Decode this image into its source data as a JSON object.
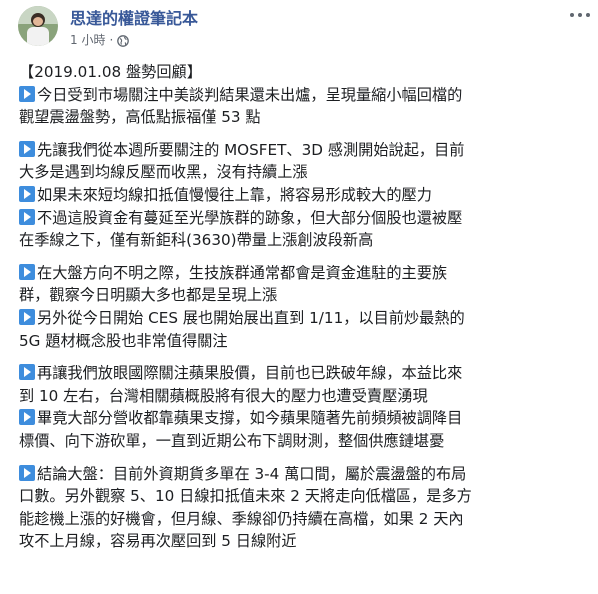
{
  "author": {
    "name": "思達的權證筆記本"
  },
  "meta": {
    "time": "1 小時",
    "separator": "·"
  },
  "icons": {
    "play": "play-button-icon",
    "globe": "globe-icon",
    "more": "more-options-icon"
  },
  "colors": {
    "author_link": "#385898",
    "icon_blue": "#3e8ddd",
    "text": "#1c1e21",
    "meta": "#616770"
  },
  "post": {
    "p1": {
      "title": "【2019.01.08 盤勢回顧】",
      "l1": "今日受到市場關注中美談判結果還未出爐，呈現量縮小幅回檔的",
      "l2": "觀望震盪盤勢，高低點振福僅 53 點"
    },
    "p2": {
      "l1": "先讓我們從本週所要關注的 MOSFET、3D 感測開始說起，目前",
      "l2": "大多是遇到均線反壓而收黑，沒有持續上漲",
      "l3": "如果未來短均線扣抵值慢慢往上靠，將容易形成較大的壓力",
      "l4": "不過這股資金有蔓延至光學族群的跡象，但大部分個股也還被壓",
      "l5": "在季線之下，僅有新鉅科(3630)帶量上漲創波段新高"
    },
    "p3": {
      "l1": "在大盤方向不明之際，生技族群通常都會是資金進駐的主要族",
      "l2": "群，觀察今日明顯大多也都是呈現上漲",
      "l3": "另外從今日開始 CES 展也開始展出直到 1/11，以目前炒最熱的",
      "l4": "5G 題材概念股也非常值得關注"
    },
    "p4": {
      "l1": "再讓我們放眼國際關注蘋果股價，目前也已跌破年線，本益比來",
      "l2": "到 10 左右，台灣相關蘋概股將有很大的壓力也遭受賣壓湧現",
      "l3": "畢竟大部分營收都靠蘋果支撐，如今蘋果隨著先前頻頻被調降目",
      "l4": "標價、向下游砍單，一直到近期公布下調財測，整個供應鏈堪憂"
    },
    "p5": {
      "l1": "結論大盤：目前外資期貨多單在 3-4 萬口間，屬於震盪盤的布局",
      "l2": "口數。另外觀察 5、10 日線扣抵值未來 2 天將走向低檔區，是多方",
      "l3": "能趁機上漲的好機會，但月線、季線卻仍持續在高檔，如果 2 天內",
      "l4": "攻不上月線，容易再次壓回到 5 日線附近"
    }
  }
}
